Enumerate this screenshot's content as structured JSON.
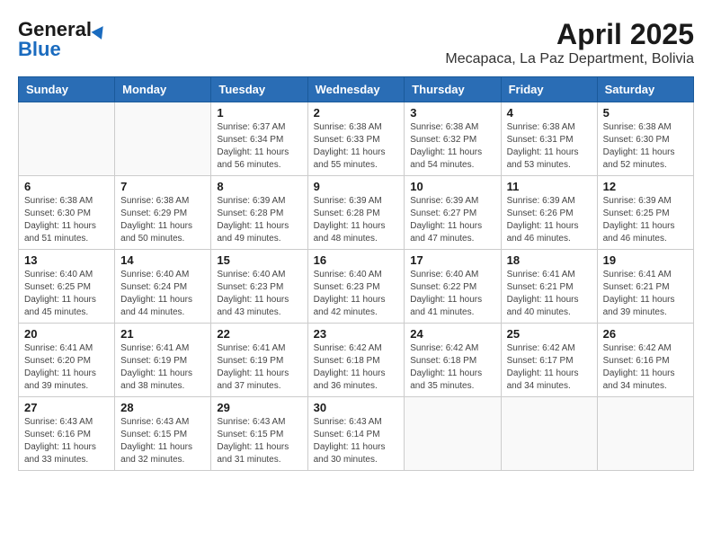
{
  "header": {
    "logo_general": "General",
    "logo_blue": "Blue",
    "month": "April 2025",
    "location": "Mecapaca, La Paz Department, Bolivia"
  },
  "days_of_week": [
    "Sunday",
    "Monday",
    "Tuesday",
    "Wednesday",
    "Thursday",
    "Friday",
    "Saturday"
  ],
  "weeks": [
    [
      {
        "day": "",
        "content": ""
      },
      {
        "day": "",
        "content": ""
      },
      {
        "day": "1",
        "content": "Sunrise: 6:37 AM\nSunset: 6:34 PM\nDaylight: 11 hours and 56 minutes."
      },
      {
        "day": "2",
        "content": "Sunrise: 6:38 AM\nSunset: 6:33 PM\nDaylight: 11 hours and 55 minutes."
      },
      {
        "day": "3",
        "content": "Sunrise: 6:38 AM\nSunset: 6:32 PM\nDaylight: 11 hours and 54 minutes."
      },
      {
        "day": "4",
        "content": "Sunrise: 6:38 AM\nSunset: 6:31 PM\nDaylight: 11 hours and 53 minutes."
      },
      {
        "day": "5",
        "content": "Sunrise: 6:38 AM\nSunset: 6:30 PM\nDaylight: 11 hours and 52 minutes."
      }
    ],
    [
      {
        "day": "6",
        "content": "Sunrise: 6:38 AM\nSunset: 6:30 PM\nDaylight: 11 hours and 51 minutes."
      },
      {
        "day": "7",
        "content": "Sunrise: 6:38 AM\nSunset: 6:29 PM\nDaylight: 11 hours and 50 minutes."
      },
      {
        "day": "8",
        "content": "Sunrise: 6:39 AM\nSunset: 6:28 PM\nDaylight: 11 hours and 49 minutes."
      },
      {
        "day": "9",
        "content": "Sunrise: 6:39 AM\nSunset: 6:28 PM\nDaylight: 11 hours and 48 minutes."
      },
      {
        "day": "10",
        "content": "Sunrise: 6:39 AM\nSunset: 6:27 PM\nDaylight: 11 hours and 47 minutes."
      },
      {
        "day": "11",
        "content": "Sunrise: 6:39 AM\nSunset: 6:26 PM\nDaylight: 11 hours and 46 minutes."
      },
      {
        "day": "12",
        "content": "Sunrise: 6:39 AM\nSunset: 6:25 PM\nDaylight: 11 hours and 46 minutes."
      }
    ],
    [
      {
        "day": "13",
        "content": "Sunrise: 6:40 AM\nSunset: 6:25 PM\nDaylight: 11 hours and 45 minutes."
      },
      {
        "day": "14",
        "content": "Sunrise: 6:40 AM\nSunset: 6:24 PM\nDaylight: 11 hours and 44 minutes."
      },
      {
        "day": "15",
        "content": "Sunrise: 6:40 AM\nSunset: 6:23 PM\nDaylight: 11 hours and 43 minutes."
      },
      {
        "day": "16",
        "content": "Sunrise: 6:40 AM\nSunset: 6:23 PM\nDaylight: 11 hours and 42 minutes."
      },
      {
        "day": "17",
        "content": "Sunrise: 6:40 AM\nSunset: 6:22 PM\nDaylight: 11 hours and 41 minutes."
      },
      {
        "day": "18",
        "content": "Sunrise: 6:41 AM\nSunset: 6:21 PM\nDaylight: 11 hours and 40 minutes."
      },
      {
        "day": "19",
        "content": "Sunrise: 6:41 AM\nSunset: 6:21 PM\nDaylight: 11 hours and 39 minutes."
      }
    ],
    [
      {
        "day": "20",
        "content": "Sunrise: 6:41 AM\nSunset: 6:20 PM\nDaylight: 11 hours and 39 minutes."
      },
      {
        "day": "21",
        "content": "Sunrise: 6:41 AM\nSunset: 6:19 PM\nDaylight: 11 hours and 38 minutes."
      },
      {
        "day": "22",
        "content": "Sunrise: 6:41 AM\nSunset: 6:19 PM\nDaylight: 11 hours and 37 minutes."
      },
      {
        "day": "23",
        "content": "Sunrise: 6:42 AM\nSunset: 6:18 PM\nDaylight: 11 hours and 36 minutes."
      },
      {
        "day": "24",
        "content": "Sunrise: 6:42 AM\nSunset: 6:18 PM\nDaylight: 11 hours and 35 minutes."
      },
      {
        "day": "25",
        "content": "Sunrise: 6:42 AM\nSunset: 6:17 PM\nDaylight: 11 hours and 34 minutes."
      },
      {
        "day": "26",
        "content": "Sunrise: 6:42 AM\nSunset: 6:16 PM\nDaylight: 11 hours and 34 minutes."
      }
    ],
    [
      {
        "day": "27",
        "content": "Sunrise: 6:43 AM\nSunset: 6:16 PM\nDaylight: 11 hours and 33 minutes."
      },
      {
        "day": "28",
        "content": "Sunrise: 6:43 AM\nSunset: 6:15 PM\nDaylight: 11 hours and 32 minutes."
      },
      {
        "day": "29",
        "content": "Sunrise: 6:43 AM\nSunset: 6:15 PM\nDaylight: 11 hours and 31 minutes."
      },
      {
        "day": "30",
        "content": "Sunrise: 6:43 AM\nSunset: 6:14 PM\nDaylight: 11 hours and 30 minutes."
      },
      {
        "day": "",
        "content": ""
      },
      {
        "day": "",
        "content": ""
      },
      {
        "day": "",
        "content": ""
      }
    ]
  ]
}
